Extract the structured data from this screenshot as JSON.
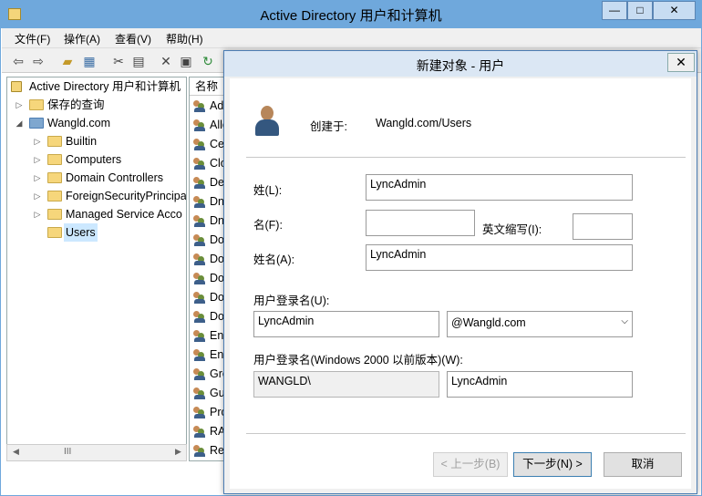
{
  "window": {
    "title": "Active Directory 用户和计算机",
    "min_label": "—",
    "max_label": "□",
    "close_label": "✕"
  },
  "menu": [
    "文件(F)",
    "操作(A)",
    "查看(V)",
    "帮助(H)"
  ],
  "toolbar_icons": [
    "back-arrow-icon",
    "forward-arrow-icon",
    "folder-up-icon",
    "console-icon",
    "cut-icon",
    "paste-icon",
    "delete-icon",
    "properties-icon",
    "refresh-icon"
  ],
  "tree": {
    "root": "Active Directory 用户和计算机",
    "saved_queries": "保存的查询",
    "domain": "Wangld.com",
    "children": [
      "Builtin",
      "Computers",
      "Domain Controllers",
      "ForeignSecurityPrincipa",
      "Managed Service Acco",
      "Users"
    ]
  },
  "list": {
    "header": "名称",
    "items": [
      "Ad",
      "Allo",
      "Cer",
      "Clo",
      "De",
      "Dn",
      "Dn",
      "Do",
      "Do",
      "Do",
      "Do",
      "Do",
      "Ent",
      "Ent",
      "Gro",
      "Gu",
      "Pro",
      "RA",
      "Rea"
    ]
  },
  "dialog": {
    "title": "新建对象 - 用户",
    "close_label": "✕",
    "create_in_label": "创建于:",
    "create_in_value": "Wangld.com/Users",
    "last_name_label": "姓(L):",
    "last_name_value": "LyncAdmin",
    "first_name_label": "名(F):",
    "first_name_value": "",
    "initials_label": "英文缩写(I):",
    "initials_value": "",
    "full_name_label": "姓名(A):",
    "full_name_value": "LyncAdmin",
    "logon_name_label": "用户登录名(U):",
    "logon_name_value": "LyncAdmin",
    "upn_suffix": "@Wangld.com",
    "pre2000_label": "用户登录名(Windows 2000 以前版本)(W):",
    "pre2000_domain": "WANGLD\\",
    "pre2000_name": "LyncAdmin",
    "back_button": "< 上一步(B)",
    "next_button": "下一步(N) >",
    "cancel_button": "取消"
  }
}
